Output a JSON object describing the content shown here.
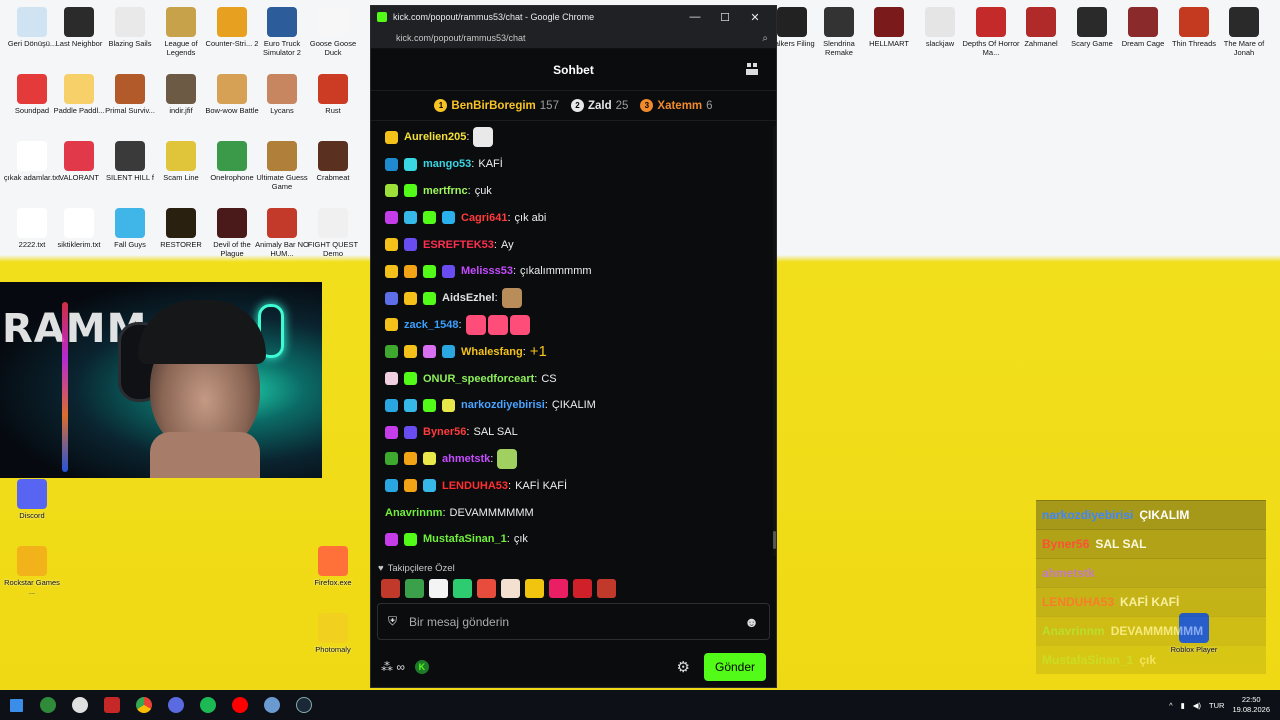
{
  "window": {
    "title": "kick.com/popout/rammus53/chat - Google Chrome",
    "url": "kick.com/popout/rammus53/chat"
  },
  "chat": {
    "title": "Sohbet",
    "leaderboard": [
      {
        "rank": "1",
        "name": "BenBirBoregim",
        "count": "157",
        "color": "#f7c325"
      },
      {
        "rank": "2",
        "name": "Zald",
        "count": "25",
        "color": "#e8e8e8"
      },
      {
        "rank": "3",
        "name": "Xatemm",
        "count": "6",
        "color": "#f08a2c"
      }
    ],
    "messages": [
      {
        "user": "Aurelien205",
        "text": "",
        "color": "#f3e03a",
        "badges": [
          "#f3c11a"
        ],
        "emotes": [
          "#e9e9e9"
        ]
      },
      {
        "user": "mango53",
        "text": "KAFİ",
        "color": "#39d6e3",
        "badges": [
          "#1e8bd0",
          "#39d6e3"
        ],
        "emotes": []
      },
      {
        "user": "mertfrnc",
        "text": "çuk",
        "color": "#9ef85b",
        "badges": [
          "#9ee03a",
          "#53fc18"
        ],
        "emotes": []
      },
      {
        "user": "Cagri641",
        "text": "çık abi",
        "color": "#ff3b3b",
        "badges": [
          "#c43de8",
          "#36b9e8",
          "#53fc18",
          "#2ab0ea"
        ],
        "emotes": []
      },
      {
        "user": "ESREFTEK53",
        "text": "Ay",
        "color": "#ff2f4e",
        "badges": [
          "#f3c11a",
          "#6a4df0"
        ],
        "emotes": []
      },
      {
        "user": "Melisss53",
        "text": "çıkalımmmmm",
        "color": "#c54bff",
        "badges": [
          "#f3c11a",
          "#f3a416",
          "#53fc18",
          "#6a4df0"
        ],
        "emotes": []
      },
      {
        "user": "AidsEzhel",
        "text": "",
        "color": "#e0e0e0",
        "badges": [
          "#5d6ee8",
          "#f3c11a",
          "#53fc18"
        ],
        "emotes": [
          "#b88d5a"
        ]
      },
      {
        "user": "zack_1548",
        "text": "",
        "color": "#3aa0ff",
        "badges": [
          "#f3c11a"
        ],
        "emotes": [
          "#ff4d7a",
          "#ff4d7a",
          "#ff4d7a"
        ]
      },
      {
        "user": "Whalesfang",
        "text": "+1",
        "color": "#f3c11a",
        "badges": [
          "#3ea82f",
          "#f3c11a",
          "#d86ef0",
          "#2aa6e0"
        ],
        "emotes": []
      },
      {
        "user": "ONUR_speedforceart",
        "text": "CS",
        "color": "#8df05b",
        "badges": [
          "#f0cfe0",
          "#53fc18"
        ],
        "emotes": []
      },
      {
        "user": "narkozdiyebirisi",
        "text": "ÇIKALIM",
        "color": "#4aa3ff",
        "badges": [
          "#2aa6e0",
          "#36b9e8",
          "#53fc18",
          "#e8e84a"
        ],
        "emotes": []
      },
      {
        "user": "Byner56",
        "text": "SAL SAL",
        "color": "#ff3b3b",
        "badges": [
          "#c43de8",
          "#6a4df0"
        ],
        "emotes": []
      },
      {
        "user": "ahmetstk",
        "text": "",
        "color": "#c54bff",
        "badges": [
          "#3ea82f",
          "#f3a416",
          "#e8e84a"
        ],
        "emotes": [
          "#a0d060"
        ]
      },
      {
        "user": "LENDUHA53",
        "text": "KAFİ KAFİ",
        "color": "#ff2f2f",
        "badges": [
          "#2aa6e0",
          "#f3a416",
          "#36b9e8"
        ],
        "emotes": []
      },
      {
        "user": "Anavrinnm",
        "text": "DEVAMMMMMM",
        "color": "#6ff03a",
        "badges": [],
        "emotes": []
      },
      {
        "user": "MustafaSinan_1",
        "text": "çık",
        "color": "#6ff03a",
        "badges": [
          "#c43de8",
          "#53fc18"
        ],
        "emotes": []
      }
    ],
    "followers_label": "Takipçilere Özel",
    "emote_colors": [
      "#c0392b",
      "#3aa04a",
      "#f4f4f4",
      "#2ecc71",
      "#e74c3c",
      "#f3e0d0",
      "#f1c40f",
      "#e91e63",
      "#d0202a",
      "#c0392b"
    ],
    "input_placeholder": "Bir mesaj gönderin",
    "send_label": "Gönder"
  },
  "overlay": {
    "messages": [
      {
        "user": "narkozdiyebirisi",
        "text": "ÇIKALIM",
        "color": "#3d86ff"
      },
      {
        "user": "Byner56",
        "text": "SAL SAL",
        "color": "#ff3b3b"
      },
      {
        "user": "ahmetstk",
        "text": "",
        "color": "#b557ff"
      },
      {
        "user": "LENDUHA53",
        "text": "KAFİ KAFİ",
        "color": "#ff3b3b"
      },
      {
        "user": "Anavrinnm",
        "text": "DEVAMMMMMM",
        "color": "#7ae34a"
      },
      {
        "user": "MustafaSinan_1",
        "text": "çık",
        "color": "#7ae34a"
      }
    ]
  },
  "desktop_icons": [
    {
      "label": "Geri Dönüşü...",
      "color": "#cfe3f3"
    },
    {
      "label": "Last Neighbor",
      "color": "#2b2b2b"
    },
    {
      "label": "Blazing Sails",
      "color": "#e9e9e9"
    },
    {
      "label": "League of Legends",
      "color": "#c8a24a"
    },
    {
      "label": "Counter-Stri... 2",
      "color": "#e8a020"
    },
    {
      "label": "Euro Truck Simulator 2",
      "color": "#2c5d9a"
    },
    {
      "label": "Goose Goose Duck",
      "color": "#f7f7f7"
    },
    {
      "label": "Soundpad",
      "color": "#e53a3a"
    },
    {
      "label": "Paddle Paddl...",
      "color": "#f7d06a"
    },
    {
      "label": "Primal Surviv...",
      "color": "#b35a2a"
    },
    {
      "label": "indir.jfif",
      "color": "#6d5a44"
    },
    {
      "label": "Bow-wow Battle",
      "color": "#d6a155"
    },
    {
      "label": "Lycans",
      "color": "#c78560"
    },
    {
      "label": "Rust",
      "color": "#cc3b24"
    },
    {
      "label": "çıkak adamlar.txt",
      "color": "#ffffff"
    },
    {
      "label": "VALORANT",
      "color": "#e2394a"
    },
    {
      "label": "SILENT HILL f",
      "color": "#3a3a3a"
    },
    {
      "label": "Scam Line",
      "color": "#e0c43a"
    },
    {
      "label": "Onelrophone",
      "color": "#3a9a4a"
    },
    {
      "label": "Ultimate Guess Game",
      "color": "#b0803a"
    },
    {
      "label": "Crabmeat",
      "color": "#5a3020"
    },
    {
      "label": "2222.txt",
      "color": "#ffffff"
    },
    {
      "label": "siktiklerim.txt",
      "color": "#ffffff"
    },
    {
      "label": "Fall Guys",
      "color": "#40b6e8"
    },
    {
      "label": "RESTORER",
      "color": "#2a2010"
    },
    {
      "label": "Devil of the Plague",
      "color": "#4a1a1a"
    },
    {
      "label": "Animaly Bar NO HUM...",
      "color": "#c43a2a"
    },
    {
      "label": "FIGHT QUEST Demo",
      "color": "#f0f0f0"
    },
    {
      "label": "walkers Filing",
      "color": "#222"
    },
    {
      "label": "Slendrina Remake",
      "color": "#333"
    },
    {
      "label": "HELLMART",
      "color": "#7a1a1a"
    },
    {
      "label": "slackjaw",
      "color": "#e5e5e5"
    },
    {
      "label": "Depths Of Horror Ma...",
      "color": "#c42a2a"
    },
    {
      "label": "Zahmanel",
      "color": "#b02a2a"
    },
    {
      "label": "Scary Game",
      "color": "#2a2a2a"
    },
    {
      "label": "Dream Cage",
      "color": "#8a2a2a"
    },
    {
      "label": "Thin Threads",
      "color": "#c43a20"
    },
    {
      "label": "The Mare of Jonah",
      "color": "#2a2a2a"
    },
    {
      "label": "Discord",
      "color": "#5865f2"
    },
    {
      "label": "Rockstar Games ...",
      "color": "#f2b21a"
    },
    {
      "label": "Firefox.exe",
      "color": "#ff7139"
    },
    {
      "label": "Roblox Player",
      "color": "#2a6ae8"
    },
    {
      "label": "Photomaly",
      "color": "#f2d020"
    }
  ],
  "taskbar": {
    "language": "TUR",
    "time": "22:50",
    "date": "19.08.2026"
  }
}
